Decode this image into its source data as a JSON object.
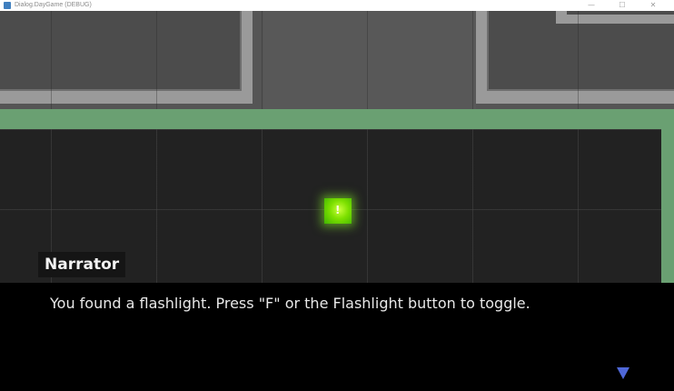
{
  "window": {
    "title": "Dialog.DayGame (DEBUG)",
    "minimize_glyph": "—",
    "maximize_glyph": "☐",
    "close_glyph": "✕"
  },
  "game": {
    "player_glyph": "!"
  },
  "dialog": {
    "speaker": "Narrator",
    "text": "You found a flashlight. Press \"F\" or the Flashlight button to toggle.",
    "continue_icon": "triangle-down-icon"
  },
  "colors": {
    "room_border": "#6aa072",
    "player": "#7de000",
    "continue_arrow": "#4f68d8",
    "dialog_bg": "#000000"
  }
}
